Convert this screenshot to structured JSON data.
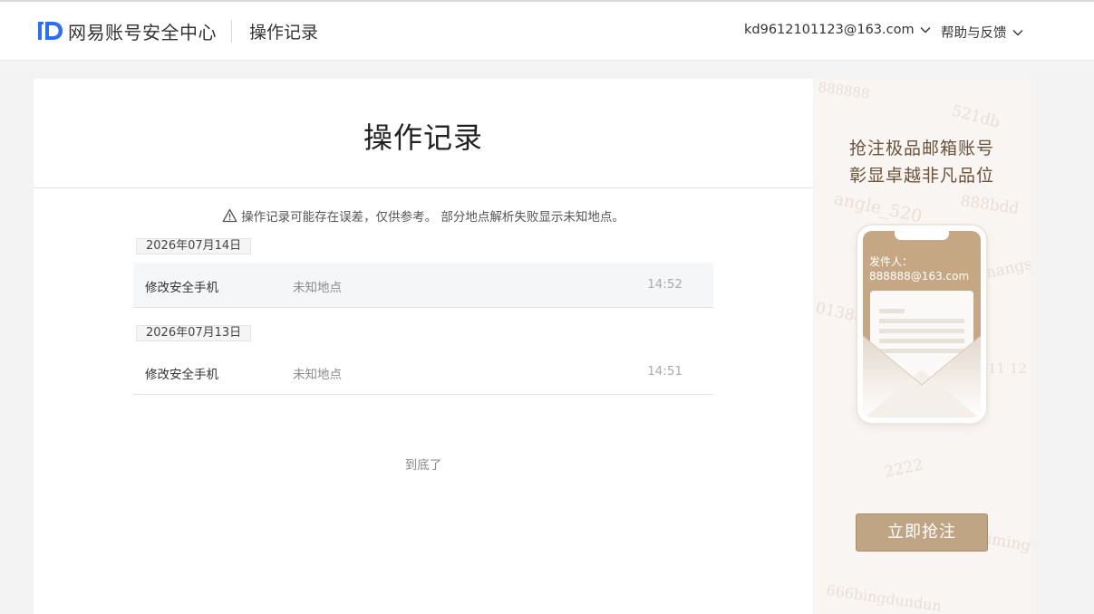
{
  "header": {
    "logo_text": "网易账号安全中心",
    "page_title": "操作记录",
    "account_email": "kd9612101123@163.com",
    "help_label": "帮助与反馈"
  },
  "main": {
    "title": "操作记录",
    "notice": "操作记录可能存在误差，仅供参考。 部分地点解析失败显示未知地点。",
    "groups": [
      {
        "date": "2026年07月14日",
        "records": [
          {
            "action": "修改安全手机",
            "location": "未知地点",
            "time": "14:52"
          }
        ]
      },
      {
        "date": "2026年07月13日",
        "records": [
          {
            "action": "修改安全手机",
            "location": "未知地点",
            "time": "14:51"
          }
        ]
      }
    ],
    "end_text": "到底了"
  },
  "ad": {
    "line1": "抢注极品邮箱账号",
    "line2": "彰显卓越非凡品位",
    "sender_label": "发件人：",
    "sender_email": "888888@163.com",
    "button_label": "立即抢注",
    "watermarks": [
      "888888",
      "521db",
      "angle_520",
      "888bdd",
      "01388",
      "hangs",
      "2222",
      "jiming",
      "666bingdundun",
      "11 12"
    ]
  },
  "colors": {
    "brand_blue": "#2b6ef7",
    "ad_gold": "#c0a584",
    "ad_text_brown": "#6b5238"
  },
  "icons": {
    "logo": "netease-id-logo",
    "dropdown": "chevron-down-icon",
    "warning": "warning-triangle-icon"
  }
}
